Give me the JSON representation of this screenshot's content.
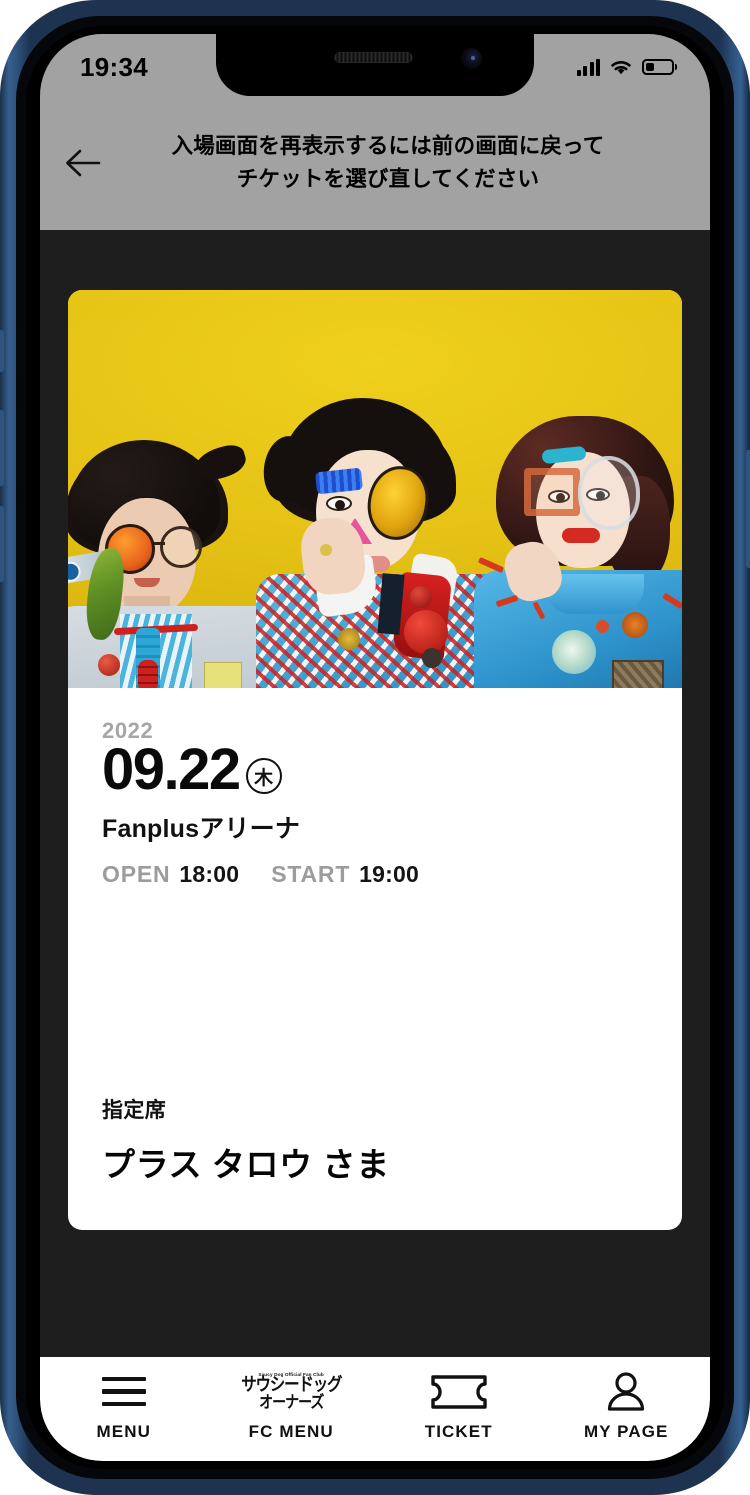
{
  "status_bar": {
    "time": "19:34",
    "signal_icon": "cellular-signal-icon",
    "wifi_icon": "wifi-icon",
    "battery_icon": "battery-icon",
    "battery_level_pct": 35
  },
  "header": {
    "back_icon": "back-arrow-icon",
    "title": "入場画面を再表示するには前の画面に戻って\nチケットを選び直してください",
    "background_color": "#a2a2a2"
  },
  "ticket": {
    "photo_alt": "artist-photo-three-members-yellow-background",
    "photo_bg_color": "#e5c215",
    "year": "2022",
    "date": "09.22",
    "weekday": "木",
    "venue": "Fanplusアリーナ",
    "open_label": "OPEN",
    "open_time": "18:00",
    "start_label": "START",
    "start_time": "19:00",
    "seat_type": "指定席",
    "holder_name": "プラス タロウ さま",
    "card_background": "#ffffff"
  },
  "bottom_nav": {
    "items": [
      {
        "label": "MENU",
        "icon": "hamburger-menu-icon"
      },
      {
        "label": "FC MENU",
        "icon": "fc-logo-icon"
      },
      {
        "label": "TICKET",
        "icon": "ticket-icon"
      },
      {
        "label": "MY PAGE",
        "icon": "person-icon"
      }
    ],
    "fc_logo": {
      "sub": "Saucy Dog Official Fan Club",
      "line1": "サウシードッグ",
      "line2": "オーナーズ"
    }
  },
  "theme": {
    "app_background": "#1e1e1e",
    "frame_color": "#24405e",
    "accent_yellow": "#e5c215"
  }
}
